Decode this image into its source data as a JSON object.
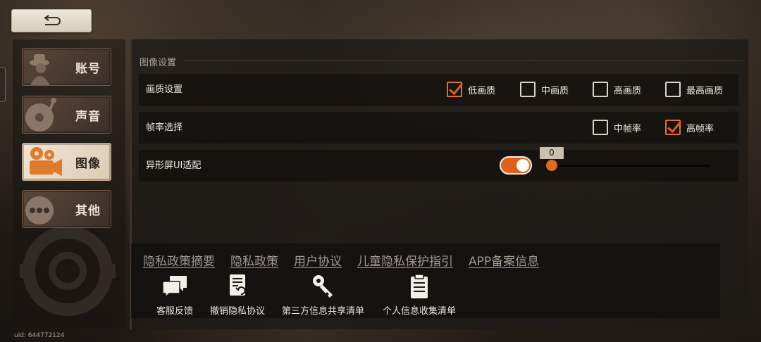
{
  "back_button": {
    "icon": "return-arrow-icon"
  },
  "sidebar": {
    "items": [
      {
        "label": "账号",
        "icon": "detective-icon",
        "active": false
      },
      {
        "label": "声音",
        "icon": "turntable-icon",
        "active": false
      },
      {
        "label": "图像",
        "icon": "film-camera-icon",
        "active": true
      },
      {
        "label": "其他",
        "icon": "more-dots-icon",
        "active": false
      }
    ]
  },
  "main": {
    "section_title": "图像设置",
    "quality": {
      "label": "画质设置",
      "options": [
        {
          "label": "低画质",
          "checked": true
        },
        {
          "label": "中画质",
          "checked": false
        },
        {
          "label": "高画质",
          "checked": false
        },
        {
          "label": "最高画质",
          "checked": false
        }
      ]
    },
    "framerate": {
      "label": "帧率选择",
      "options": [
        {
          "label": "中帧率",
          "checked": false
        },
        {
          "label": "高帧率",
          "checked": true
        }
      ]
    },
    "notch": {
      "label": "异形屏UI适配",
      "toggle_on": true,
      "slider_value": "0"
    }
  },
  "bottom": {
    "links": [
      "隐私政策摘要",
      "隐私政策",
      "用户协议",
      "儿童隐私保护指引",
      "APP备案信息"
    ],
    "tools": [
      {
        "label": "客服反馈",
        "icon": "chat-bubbles-icon"
      },
      {
        "label": "撤销隐私协议",
        "icon": "revoke-document-icon"
      },
      {
        "label": "第三方信息共享清单",
        "icon": "key-icon"
      },
      {
        "label": "个人信息收集清单",
        "icon": "clipboard-icon"
      }
    ]
  },
  "uid": "uid: 644772124",
  "colors": {
    "accent": "#e0601b",
    "active_tab": "#e9dcc8"
  }
}
